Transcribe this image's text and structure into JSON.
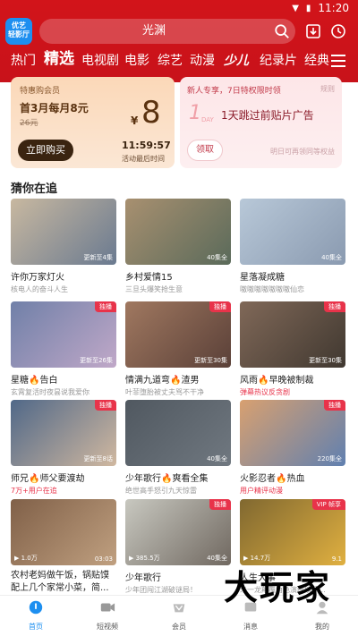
{
  "status_bar": {
    "time": "11:20"
  },
  "logo_text": "优艺\n轻影厅",
  "search": {
    "text": "光渊"
  },
  "tabs": [
    "热门",
    "精选",
    "电视剧",
    "电影",
    "综艺",
    "动漫",
    "少儿",
    "纪录片",
    "经典"
  ],
  "active_tab": "精选",
  "promo_left": {
    "label": "特惠购会员",
    "title": "首3月每月8元",
    "original_price": "26元",
    "currency": "¥",
    "price": "8",
    "button": "立即购买",
    "countdown": "11:59:57",
    "countdown_note": "活动最后时间"
  },
  "promo_right": {
    "label": "新人专享，7日特权限时领",
    "rule": "规则",
    "big": "1",
    "day": "DAY",
    "title": "1天跳过前贴片广告",
    "button": "领取",
    "note": "明日可再领同等权益"
  },
  "section_title": "猜你在追",
  "cards": [
    {
      "title": "许你万家灯火",
      "subtitle": "核电人的奋斗人生",
      "badge": "更新至4集",
      "tag": "",
      "colors": [
        "#c8b8a0",
        "#6a7a90"
      ]
    },
    {
      "title": "乡村爱情15",
      "subtitle": "三旦头爆笑抢生意",
      "badge": "40集全",
      "tag": "",
      "colors": [
        "#a89070",
        "#5a6a5a"
      ]
    },
    {
      "title": "星落凝成糖",
      "subtitle": "嗷嗷嗷嗷嗷嗷嗷仙恋",
      "badge": "40集全",
      "tag": "",
      "colors": [
        "#b8c8d8",
        "#8a9ab0"
      ]
    },
    {
      "title": "星糖🔥告白",
      "subtitle": "玄霄复活时夜昙说我爱你",
      "badge": "更新至26集",
      "tag": "独播",
      "colors": [
        "#7080a8",
        "#c0a8c8"
      ]
    },
    {
      "title": "情满九道弯🔥渣男",
      "subtitle": "叶菲堕胎被丈夫骂不干净",
      "badge": "更新至30集",
      "tag": "独播",
      "colors": [
        "#a07860",
        "#5a4038"
      ]
    },
    {
      "title": "风雨🔥早晚被制裁",
      "subtitle": "弹幕热议反贪剧",
      "badge": "更新至30集",
      "tag": "独播",
      "colors": [
        "#806858",
        "#403830"
      ],
      "hot": true
    },
    {
      "title": "师兄🔥师父要渡劫",
      "subtitle": "7万+用户在追",
      "badge": "更新至8话",
      "tag": "独播",
      "colors": [
        "#506888",
        "#d0b8a0"
      ],
      "hot": true
    },
    {
      "title": "少年歌行🔥爽看全集",
      "subtitle": "绝世高手怒引九天惊雷",
      "badge": "40集全",
      "tag": "",
      "colors": [
        "#505860",
        "#707880"
      ]
    },
    {
      "title": "火影忍者🔥热血",
      "subtitle": "用户精评动漫",
      "badge": "220集全",
      "tag": "独播",
      "colors": [
        "#d8a070",
        "#6080b0"
      ],
      "hot": true
    },
    {
      "title": "农村老妈做午饭，锅贴馍配上几个家常小菜，简...",
      "subtitle": "",
      "badge": "03:03",
      "badge_left": "▶ 1.0万",
      "tag": "",
      "colors": [
        "#806048",
        "#c0a080"
      ],
      "two": true
    },
    {
      "title": "少年歌行",
      "subtitle": "少年团闯江湖破谜局！",
      "badge": "40集全",
      "badge_left": "▶ 385.5万",
      "tag": "独播",
      "colors": [
        "#c8c8c0",
        "#706860"
      ]
    },
    {
      "title": "人生大事",
      "subtitle": "朱一龙颠覆角色演绎殡葬...",
      "badge": "9.1",
      "badge_left": "▶ 14.7万",
      "tag": "VIP 帧享",
      "colors": [
        "#806830",
        "#e0b040"
      ]
    }
  ],
  "bottom_nav": [
    {
      "label": "首页",
      "icon": "home-icon",
      "active": true
    },
    {
      "label": "短视频",
      "icon": "video-icon",
      "active": false
    },
    {
      "label": "会员",
      "icon": "vip-icon",
      "active": false
    },
    {
      "label": "消息",
      "icon": "message-icon",
      "active": false
    },
    {
      "label": "我的",
      "icon": "profile-icon",
      "active": false
    }
  ],
  "watermark": "大玩家",
  "colors": {
    "brand_red": "#d2141a",
    "accent_blue": "#1d8ff0",
    "tag_red": "#e8334a"
  }
}
